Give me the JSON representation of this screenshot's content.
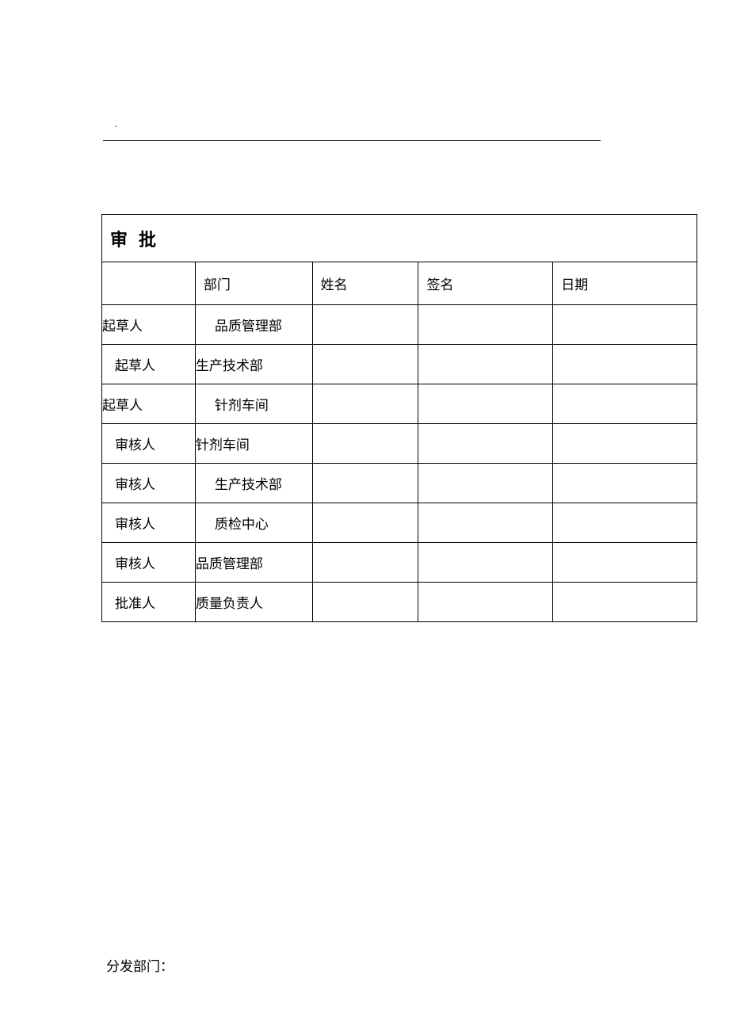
{
  "dot": "·",
  "table": {
    "title": "审批",
    "headers": {
      "role": "",
      "dept": "部门",
      "name": "姓名",
      "sign": "签名",
      "date": "日期"
    },
    "rows": [
      {
        "role": "起草人",
        "dept": "品质管理部",
        "name": "",
        "sign": "",
        "date": "",
        "roleIndent": false,
        "deptIndent": true
      },
      {
        "role": "起草人",
        "dept": "生产技术部",
        "name": "",
        "sign": "",
        "date": "",
        "roleIndent": true,
        "deptIndent": false
      },
      {
        "role": "起草人",
        "dept": "针剂车间",
        "name": "",
        "sign": "",
        "date": "",
        "roleIndent": false,
        "deptIndent": true
      },
      {
        "role": "审核人",
        "dept": "针剂车间",
        "name": "",
        "sign": "",
        "date": "",
        "roleIndent": true,
        "deptIndent": false
      },
      {
        "role": "审核人",
        "dept": "生产技术部",
        "name": "",
        "sign": "",
        "date": "",
        "roleIndent": true,
        "deptIndent": true
      },
      {
        "role": "审核人",
        "dept": "质检中心",
        "name": "",
        "sign": "",
        "date": "",
        "roleIndent": true,
        "deptIndent": true
      },
      {
        "role": "审核人",
        "dept": "品质管理部",
        "name": "",
        "sign": "",
        "date": "",
        "roleIndent": true,
        "deptIndent": false
      },
      {
        "role": "批准人",
        "dept": "质量负责人",
        "name": "",
        "sign": "",
        "date": "",
        "roleIndent": true,
        "deptIndent": false
      }
    ]
  },
  "distribution": "分发部门："
}
